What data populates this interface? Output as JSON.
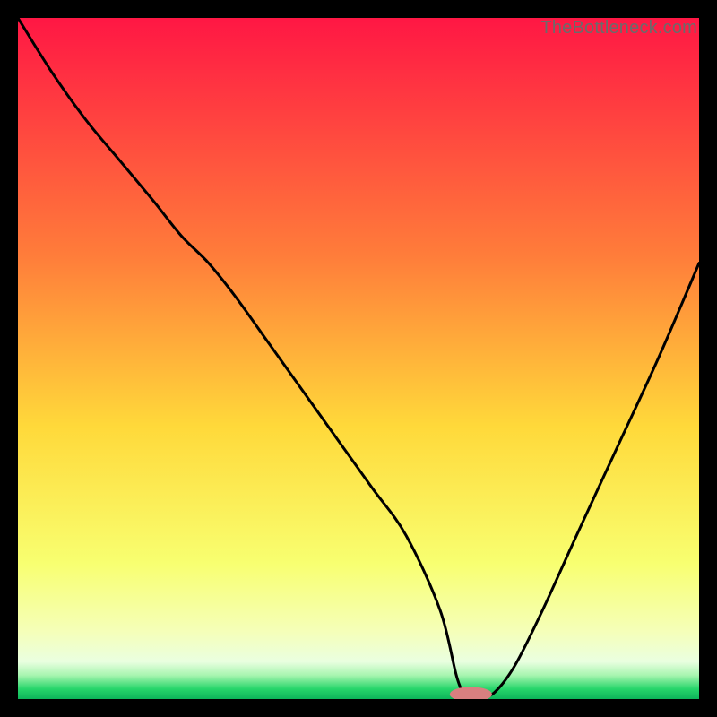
{
  "watermark": "TheBottleneck.com",
  "chart_data": {
    "type": "line",
    "title": "",
    "xlabel": "",
    "ylabel": "",
    "xlim": [
      0,
      100
    ],
    "ylim": [
      0,
      100
    ],
    "gradient_stops": [
      {
        "offset": 0,
        "color": "#ff1744"
      },
      {
        "offset": 0.35,
        "color": "#ff7d3a"
      },
      {
        "offset": 0.6,
        "color": "#ffd93a"
      },
      {
        "offset": 0.8,
        "color": "#f8ff70"
      },
      {
        "offset": 0.9,
        "color": "#f5ffb8"
      },
      {
        "offset": 0.945,
        "color": "#eaffe0"
      },
      {
        "offset": 0.965,
        "color": "#a8f5b0"
      },
      {
        "offset": 0.985,
        "color": "#27d66b"
      },
      {
        "offset": 1.0,
        "color": "#0db45a"
      }
    ],
    "series": [
      {
        "name": "bottleneck-curve",
        "x": [
          0,
          5,
          10,
          15,
          20,
          24,
          28,
          32,
          37,
          42,
          47,
          52,
          57,
          62,
          64.5,
          66,
          68,
          70,
          73,
          77,
          82,
          88,
          94,
          100
        ],
        "values": [
          100,
          92,
          85,
          79,
          73,
          68,
          64,
          59,
          52,
          45,
          38,
          31,
          24,
          13,
          3,
          0.3,
          0.3,
          1,
          5,
          13,
          24,
          37,
          50,
          64
        ]
      }
    ],
    "marker": {
      "name": "optimal-range",
      "x": 66.5,
      "y": 0.7,
      "rx": 3.1,
      "ry": 1.1,
      "color": "#d97f80"
    }
  }
}
